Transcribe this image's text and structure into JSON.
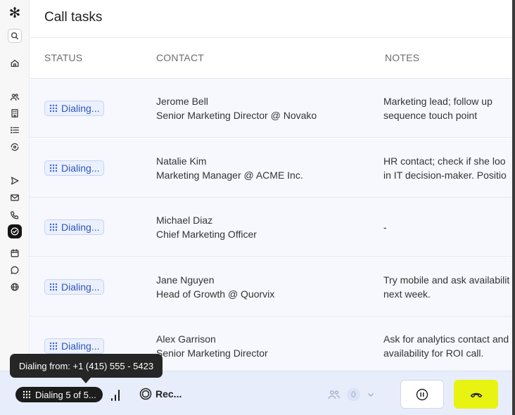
{
  "page": {
    "title": "Call tasks"
  },
  "columns": {
    "status": "STATUS",
    "contact": "CONTACT",
    "notes": "NOTES"
  },
  "rows": [
    {
      "status": "Dialing...",
      "name": "Jerome Bell",
      "role": "Senior Marketing Director @ Novako",
      "notes1": "Marketing lead; follow up",
      "notes2": "sequence touch point"
    },
    {
      "status": "Dialing...",
      "name": "Natalie Kim",
      "role": "Marketing Manager @ ACME Inc.",
      "notes1": "HR contact; check if she loo",
      "notes2": "in IT decision-maker.  Positio"
    },
    {
      "status": "Dialing...",
      "name": "Michael Diaz",
      "role": "Chief Marketing Officer",
      "notes1": "-",
      "notes2": ""
    },
    {
      "status": "Dialing...",
      "name": "Jane Nguyen",
      "role": "Head of Growth @ Quorvix",
      "notes1": "Try mobile and ask availabilit",
      "notes2": "next week."
    },
    {
      "status": "Dialing...",
      "name": "Alex Garrison",
      "role": "Senior Marketing Director",
      "notes1": "Ask for analytics contact and",
      "notes2": "availability for ROI call."
    }
  ],
  "callbar": {
    "dialing_label": "Dialing 5 of 5...",
    "dialing_shown": "Dialing 5 of 5...",
    "rec_label": "Rec...",
    "participants_count": "0",
    "tooltip": "Dialing from: +1 (415) 555 - 5423"
  },
  "sidebar": {
    "icons": [
      "logo-icon",
      "search-icon",
      "home-icon",
      "people-icon",
      "building-icon",
      "list-icon",
      "eye-sync-icon",
      "send-icon",
      "mail-icon",
      "phone-icon",
      "tasks-check-icon",
      "calendar-icon",
      "chat-icon",
      "globe-icon"
    ]
  },
  "colors": {
    "accent": "#3c62c9",
    "hangup": "#e8f312",
    "row_bg": "#f6f8fe",
    "callbar_bg": "#e7edfb"
  }
}
